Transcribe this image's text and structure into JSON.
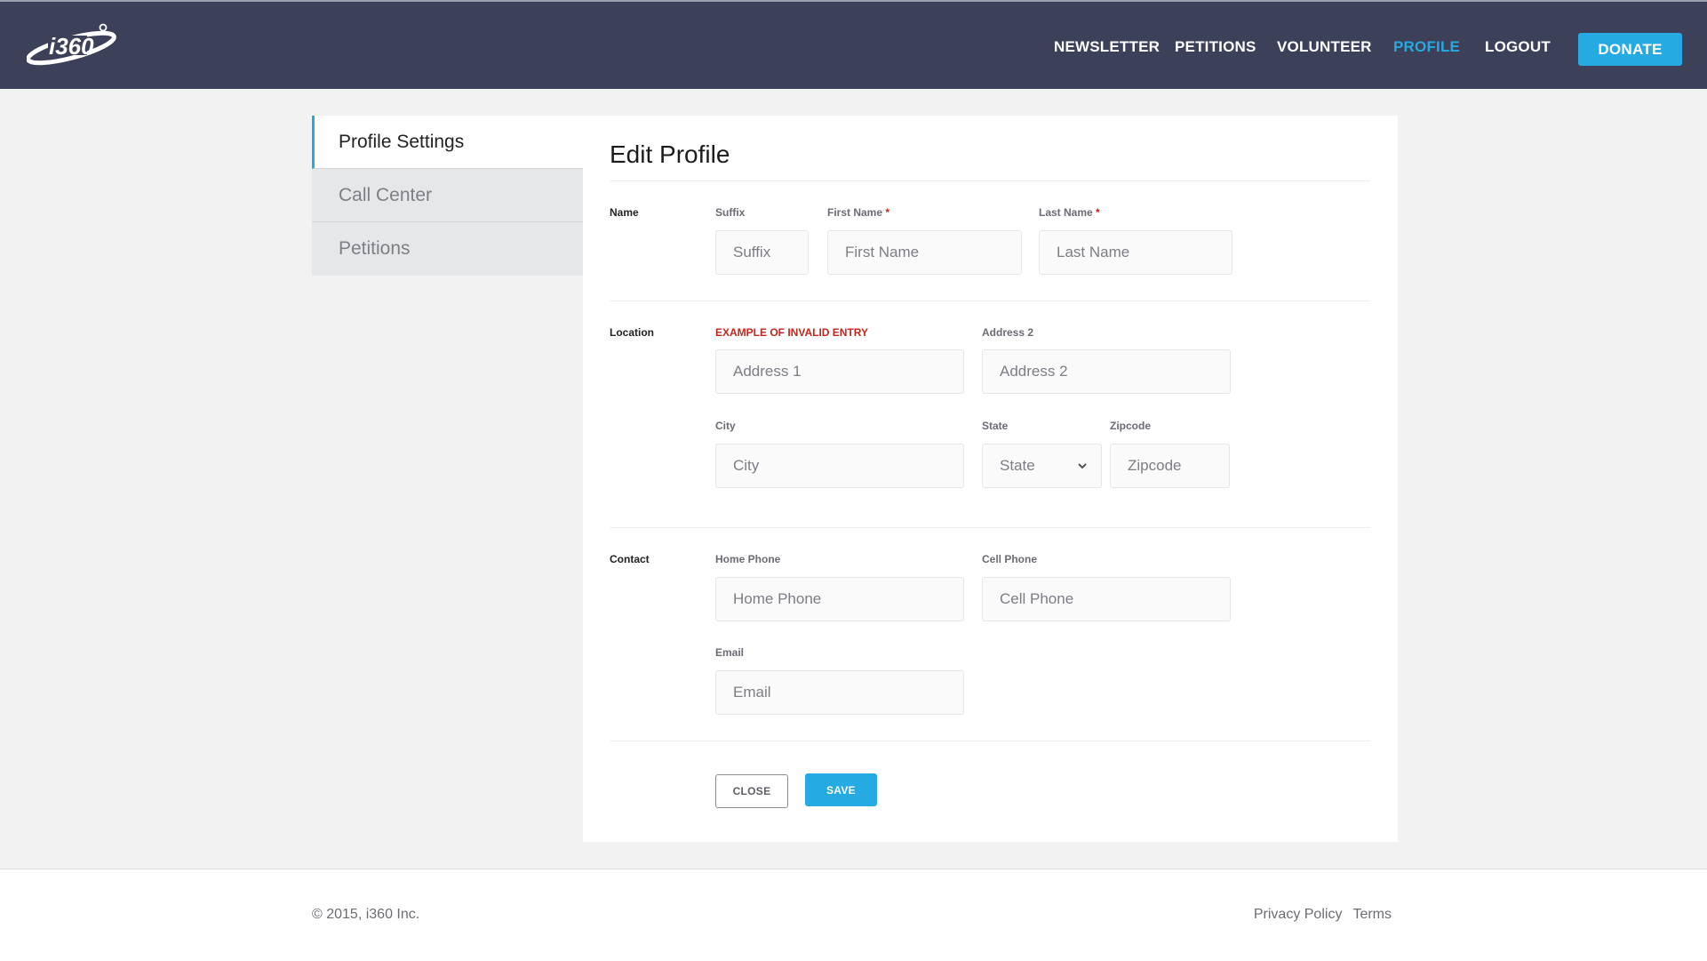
{
  "header": {
    "logo_text": "i360",
    "logo_icon": "i360-orbit-logo",
    "nav": [
      {
        "label": "NEWSLETTER",
        "active": false
      },
      {
        "label": "PETITIONS",
        "active": false
      },
      {
        "label": "VOLUNTEER",
        "active": false
      },
      {
        "label": "PROFILE",
        "active": true
      },
      {
        "label": "LOGOUT",
        "active": false
      }
    ],
    "donate_label": "DONATE"
  },
  "sidebar": {
    "items": [
      {
        "label": "Profile Settings",
        "active": true
      },
      {
        "label": "Call Center",
        "active": false
      },
      {
        "label": "Petitions",
        "active": false
      }
    ]
  },
  "form": {
    "title": "Edit Profile",
    "sections": {
      "name": {
        "label": "Name",
        "suffix": {
          "label": "Suffix",
          "placeholder": "Suffix",
          "value": ""
        },
        "first_name": {
          "label": "First Name",
          "required_mark": "*",
          "placeholder": "First Name",
          "value": ""
        },
        "last_name": {
          "label": "Last Name",
          "required_mark": "*",
          "placeholder": "Last Name",
          "value": ""
        }
      },
      "location": {
        "label": "Location",
        "address1": {
          "label": "EXAMPLE OF INVALID ENTRY",
          "placeholder": "Address 1",
          "value": "",
          "invalid": true
        },
        "address2": {
          "label": "Address 2",
          "placeholder": "Address 2",
          "value": ""
        },
        "city": {
          "label": "City",
          "placeholder": "City",
          "value": ""
        },
        "state": {
          "label": "State",
          "selected": "State",
          "icon": "chevron-down-icon"
        },
        "zipcode": {
          "label": "Zipcode",
          "placeholder": "Zipcode",
          "value": ""
        }
      },
      "contact": {
        "label": "Contact",
        "home_phone": {
          "label": "Home Phone",
          "placeholder": "Home Phone",
          "value": ""
        },
        "cell_phone": {
          "label": "Cell Phone",
          "placeholder": "Cell Phone",
          "value": ""
        },
        "email": {
          "label": "Email",
          "placeholder": "Email",
          "value": ""
        }
      }
    },
    "close_label": "CLOSE",
    "save_label": "SAVE"
  },
  "footer": {
    "copyright": "© 2015, i360 Inc.",
    "links": [
      "Privacy Policy",
      "Terms"
    ]
  },
  "colors": {
    "header_bg": "#3c4059",
    "accent": "#25aae1",
    "error": "#c0271f",
    "page_bg": "#f2f2f2"
  }
}
